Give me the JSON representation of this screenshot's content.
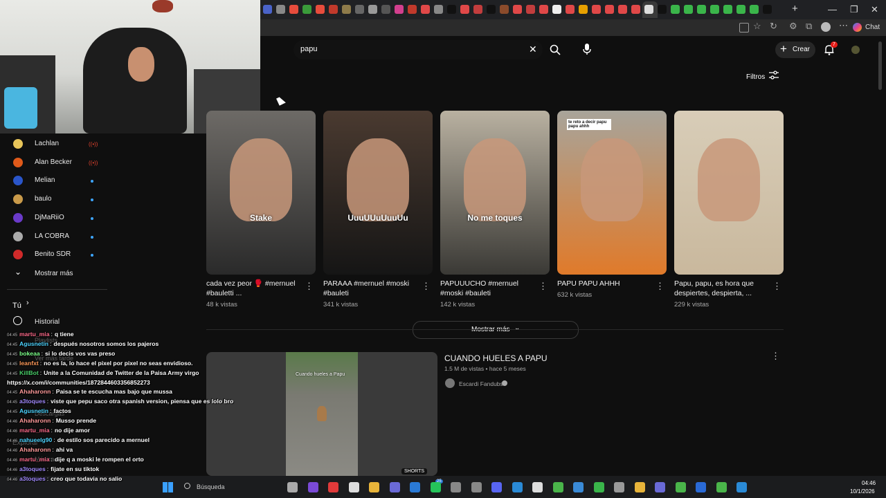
{
  "browser": {
    "tabs_close_glyph": "✕",
    "new_tab_glyph": "+",
    "window_controls": [
      "—",
      "❐",
      "✕"
    ],
    "chat_label": "Chat",
    "tab_icon_colors": [
      "#4a63c9",
      "#888",
      "#e74c3c",
      "#3a9b3a",
      "#e74c3c",
      "#c0392b",
      "#8e7b4a",
      "#666",
      "#999",
      "#555",
      "#d23f8e",
      "#c0392b",
      "#e04848",
      "#888",
      "#111",
      "#e04848",
      "#c23d3d",
      "#111",
      "#8b4b2b",
      "#e04848",
      "#c23d3d",
      "#e04848",
      "#eee",
      "#e04848",
      "#e6a000",
      "#e04848",
      "#e04848",
      "#e04848",
      "#e04848",
      "#ddd",
      "#111",
      "#3ab54a",
      "#3ab54a",
      "#3ab54a",
      "#3ab54a",
      "#3ab54a",
      "#3ab54a",
      "#3ab54a",
      "#111"
    ]
  },
  "youtube": {
    "search_value": "papu",
    "create_label": "Crear",
    "notif_count": "7",
    "filters_label": "Filtros",
    "show_more": "Mostrar más",
    "videos": [
      {
        "title": "cada vez peor 🥊 #mernuel #bauletti ...",
        "views": "48 k vistas",
        "overlay": "Stake",
        "bg": "#6d6a66",
        "bg2": "#2a2a2a"
      },
      {
        "title": "PARAAA #mernuel #moski #bauleti",
        "views": "341 k vistas",
        "overlay": "UuuUUuUuuUu",
        "bg": "#4a3a30",
        "bg2": "#151515"
      },
      {
        "title": "PAPUUUCHO #mernuel #moski #bauleti",
        "views": "142 k vistas",
        "overlay": "No me toques",
        "bg": "#b9b1a1",
        "bg2": "#3a3935"
      },
      {
        "title": "PAPU PAPU AHHH",
        "views": "632 k vistas",
        "overlay": "te reto a decir papu papu ahhh",
        "bg": "#a8a49a",
        "bg2": "#e07a2a"
      },
      {
        "title": "Papu, papu, es hora que despiertes, despierta, ...",
        "views": "229 k vistas",
        "overlay": "",
        "bg": "#d8cdb8",
        "bg2": "#c9b89d"
      }
    ],
    "featured": {
      "title": "CUANDO HUELES A PAPU",
      "meta": "1.5 M de vistas • hace 5 meses",
      "channel": "Escardi Fandubs",
      "thumb_text": "Cuando hueles a Papu",
      "badge": "SHORTS"
    }
  },
  "sidebar": {
    "subs": [
      {
        "name": "Lachlan",
        "status": "live",
        "color": "#e8c55a"
      },
      {
        "name": "Alan Becker",
        "status": "live",
        "color": "#e05a1a"
      },
      {
        "name": "Melian",
        "status": "new",
        "color": "#2a55c9"
      },
      {
        "name": "baulo",
        "status": "new",
        "color": "#c99a4a"
      },
      {
        "name": "DjMaRiiO",
        "status": "new",
        "color": "#6a3ac9"
      },
      {
        "name": "LA COBRA",
        "status": "new",
        "color": "#aaa"
      },
      {
        "name": "Benito SDR",
        "status": "new",
        "color": "#d02a2a"
      }
    ],
    "show_more": "Mostrar más",
    "you": "Tú",
    "history": "Historial",
    "ghost_items": [
      "Playlists",
      "Ver más tarde",
      "Descargas",
      "Explorar",
      "Música"
    ]
  },
  "chat": [
    {
      "t": "04:45",
      "u": "martu_mia",
      "c": "#ff6b8b",
      "m": "q tiene"
    },
    {
      "t": "04:45",
      "u": "Agusnetin",
      "c": "#4ed4ff",
      "m": "después nosotros somos los pajeros"
    },
    {
      "t": "04:45",
      "u": "bokeaa",
      "c": "#7dff8a",
      "m": "si lo decis vos vas preso"
    },
    {
      "t": "04:45",
      "u": "leanfxt",
      "c": "#ff9a5a",
      "m": "no es la, lo hace el pixel por pixel no seas envidioso."
    },
    {
      "t": "04:45",
      "u": "KillBot",
      "c": "#4ad06a",
      "m": "Unite a la Comunidad de Twitter de la Paisa Army virgo"
    },
    {
      "t": "",
      "u": "",
      "c": "#fff",
      "m": "https://x.com/i/communities/1872844603356852273"
    },
    {
      "t": "04:45",
      "u": "Ahaharonn",
      "c": "#ff9a9a",
      "m": "Paisa se te escucha mas bajo que mussa"
    },
    {
      "t": "04:45",
      "u": "a3toques",
      "c": "#a38bff",
      "m": "viste que pepu saco otra spanish version, piensa que es lolo bro"
    },
    {
      "t": "04:45",
      "u": "Agusnetin",
      "c": "#4ed4ff",
      "m": "factos"
    },
    {
      "t": "04:46",
      "u": "Ahaharonn",
      "c": "#ff9a9a",
      "m": "Musso prende"
    },
    {
      "t": "04:46",
      "u": "martu_mia",
      "c": "#ff6b8b",
      "m": "no dije amor"
    },
    {
      "t": "04:46",
      "u": "nahueelg90",
      "c": "#4ed4ff",
      "m": "de estilo sos parecido a mernuel"
    },
    {
      "t": "04:46",
      "u": "Ahaharonn",
      "c": "#ff9a9a",
      "m": "ahi va"
    },
    {
      "t": "04:46",
      "u": "martu_mia",
      "c": "#ff6b8b",
      "m": "dije q a moski le rompen el orto"
    },
    {
      "t": "04:46",
      "u": "a3toques",
      "c": "#a38bff",
      "m": "fijate en su tiktok"
    },
    {
      "t": "04:46",
      "u": "a3toques",
      "c": "#a38bff",
      "m": "creo que todavia no salio"
    }
  ],
  "taskbar": {
    "search_placeholder": "Búsqueda",
    "time": "04:46",
    "date": "10/1/2026",
    "badge": "25",
    "icon_colors": [
      "#aaa",
      "#7a4ad6",
      "#e03a3a",
      "#ddd",
      "#e8b43a",
      "#6a6ad6",
      "#2a7ad6",
      "#25c45a",
      "#888",
      "#888",
      "#5865f2",
      "#2a8ad6",
      "#ddd",
      "#4ab54a",
      "#3a8ad6",
      "#3ab54a",
      "#999",
      "#e8b43a",
      "#6a6ad6",
      "#4ab54a",
      "#2a6ad6",
      "#4ab54a",
      "#2a8ad6"
    ]
  }
}
